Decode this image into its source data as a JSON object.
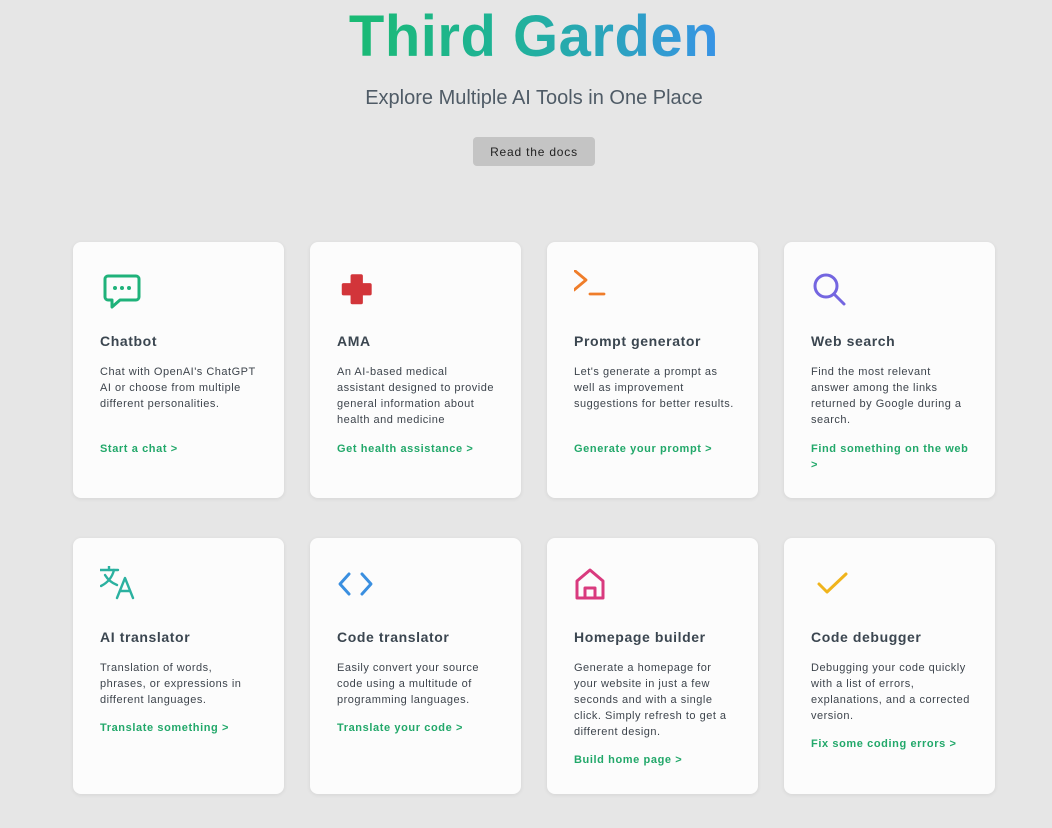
{
  "header": {
    "title": "Third Garden",
    "subtitle": "Explore Multiple AI Tools in One Place",
    "docs_button": "Read the docs"
  },
  "colors": {
    "title_gradient_start": "#1aba73",
    "title_gradient_end": "#3893e6",
    "link": "#22a86a"
  },
  "cards": [
    {
      "icon": "chat-bubble-icon",
      "title": "Chatbot",
      "description": "Chat with OpenAI's ChatGPT AI or choose from multiple different personalities.",
      "link": "Start a chat >"
    },
    {
      "icon": "medical-cross-icon",
      "title": "AMA",
      "description": "An AI-based medical assistant designed to provide general information about health and medicine",
      "link": "Get health assistance >"
    },
    {
      "icon": "terminal-prompt-icon",
      "title": "Prompt generator",
      "description": "Let's generate a prompt as well as improvement suggestions for better results.",
      "link": "Generate your prompt >"
    },
    {
      "icon": "search-icon",
      "title": "Web search",
      "description": "Find the most relevant answer among the links returned by Google during a search.",
      "link": "Find something on the web >"
    },
    {
      "icon": "translate-icon",
      "title": "AI translator",
      "description": "Translation of words, phrases, or expressions in different languages.",
      "link": "Translate something >"
    },
    {
      "icon": "code-brackets-icon",
      "title": "Code translator",
      "description": "Easily convert your source code using a multitude of programming languages.",
      "link": "Translate your code >"
    },
    {
      "icon": "home-icon",
      "title": "Homepage builder",
      "description": "Generate a homepage for your website in just a few seconds and with a single click. Simply refresh to get a different design.",
      "link": "Build home page >"
    },
    {
      "icon": "checkmark-icon",
      "title": "Code debugger",
      "description": "Debugging your code quickly with a list of errors, explanations, and a corrected version.",
      "link": "Fix some coding errors >"
    }
  ]
}
